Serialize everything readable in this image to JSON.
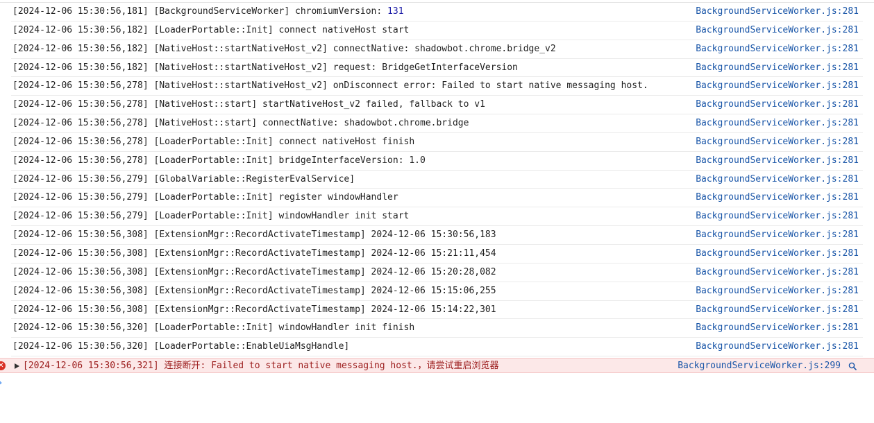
{
  "logs": [
    {
      "msg": "[2024-12-06 15:30:56,181] [BackgroundServiceWorker] chromiumVersion: ",
      "num": "131",
      "src": "BackgroundServiceWorker.js:281"
    },
    {
      "msg": "[2024-12-06 15:30:56,182] [LoaderPortable::Init] connect nativeHost start",
      "num": "",
      "src": "BackgroundServiceWorker.js:281"
    },
    {
      "msg": "[2024-12-06 15:30:56,182] [NativeHost::startNativeHost_v2] connectNative: shadowbot.chrome.bridge_v2",
      "num": "",
      "src": "BackgroundServiceWorker.js:281"
    },
    {
      "msg": "[2024-12-06 15:30:56,182] [NativeHost::startNativeHost_v2] request: BridgeGetInterfaceVersion",
      "num": "",
      "src": "BackgroundServiceWorker.js:281"
    },
    {
      "msg": "[2024-12-06 15:30:56,278] [NativeHost::startNativeHost_v2] onDisconnect error: Failed to start native messaging host.",
      "num": "",
      "src": "BackgroundServiceWorker.js:281"
    },
    {
      "msg": "[2024-12-06 15:30:56,278] [NativeHost::start] startNativeHost_v2 failed, fallback to v1",
      "num": "",
      "src": "BackgroundServiceWorker.js:281"
    },
    {
      "msg": "[2024-12-06 15:30:56,278] [NativeHost::start] connectNative: shadowbot.chrome.bridge",
      "num": "",
      "src": "BackgroundServiceWorker.js:281"
    },
    {
      "msg": "[2024-12-06 15:30:56,278] [LoaderPortable::Init] connect nativeHost finish",
      "num": "",
      "src": "BackgroundServiceWorker.js:281"
    },
    {
      "msg": "[2024-12-06 15:30:56,278] [LoaderPortable::Init] bridgeInterfaceVersion: 1.0",
      "num": "",
      "src": "BackgroundServiceWorker.js:281"
    },
    {
      "msg": "[2024-12-06 15:30:56,279] [GlobalVariable::RegisterEvalService]",
      "num": "",
      "src": "BackgroundServiceWorker.js:281"
    },
    {
      "msg": "[2024-12-06 15:30:56,279] [LoaderPortable::Init] register windowHandler",
      "num": "",
      "src": "BackgroundServiceWorker.js:281"
    },
    {
      "msg": "[2024-12-06 15:30:56,279] [LoaderPortable::Init] windowHandler init start",
      "num": "",
      "src": "BackgroundServiceWorker.js:281"
    },
    {
      "msg": "[2024-12-06 15:30:56,308] [ExtensionMgr::RecordActivateTimestamp] 2024-12-06 15:30:56,183",
      "num": "",
      "src": "BackgroundServiceWorker.js:281"
    },
    {
      "msg": "[2024-12-06 15:30:56,308] [ExtensionMgr::RecordActivateTimestamp] 2024-12-06 15:21:11,454",
      "num": "",
      "src": "BackgroundServiceWorker.js:281"
    },
    {
      "msg": "[2024-12-06 15:30:56,308] [ExtensionMgr::RecordActivateTimestamp] 2024-12-06 15:20:28,082",
      "num": "",
      "src": "BackgroundServiceWorker.js:281"
    },
    {
      "msg": "[2024-12-06 15:30:56,308] [ExtensionMgr::RecordActivateTimestamp] 2024-12-06 15:15:06,255",
      "num": "",
      "src": "BackgroundServiceWorker.js:281"
    },
    {
      "msg": "[2024-12-06 15:30:56,308] [ExtensionMgr::RecordActivateTimestamp] 2024-12-06 15:14:22,301",
      "num": "",
      "src": "BackgroundServiceWorker.js:281"
    },
    {
      "msg": "[2024-12-06 15:30:56,320] [LoaderPortable::Init] windowHandler init finish",
      "num": "",
      "src": "BackgroundServiceWorker.js:281"
    },
    {
      "msg": "[2024-12-06 15:30:56,320] [LoaderPortable::EnableUiaMsgHandle]",
      "num": "",
      "src": "BackgroundServiceWorker.js:281"
    }
  ],
  "error": {
    "msg": "[2024-12-06 15:30:56,321] 连接断开: Failed to start native messaging host.，请尝试重启浏览器",
    "src": "BackgroundServiceWorker.js:299",
    "icon": "error-icon",
    "expand_icon": "expand-arrow-icon",
    "search_icon": "search-icon"
  },
  "prompt": {
    "glyph": "›"
  },
  "colors": {
    "link": "#1a56a8",
    "number": "#1a1aa6",
    "error_bg": "#fce8e8",
    "error_text": "#9b1c1c"
  }
}
